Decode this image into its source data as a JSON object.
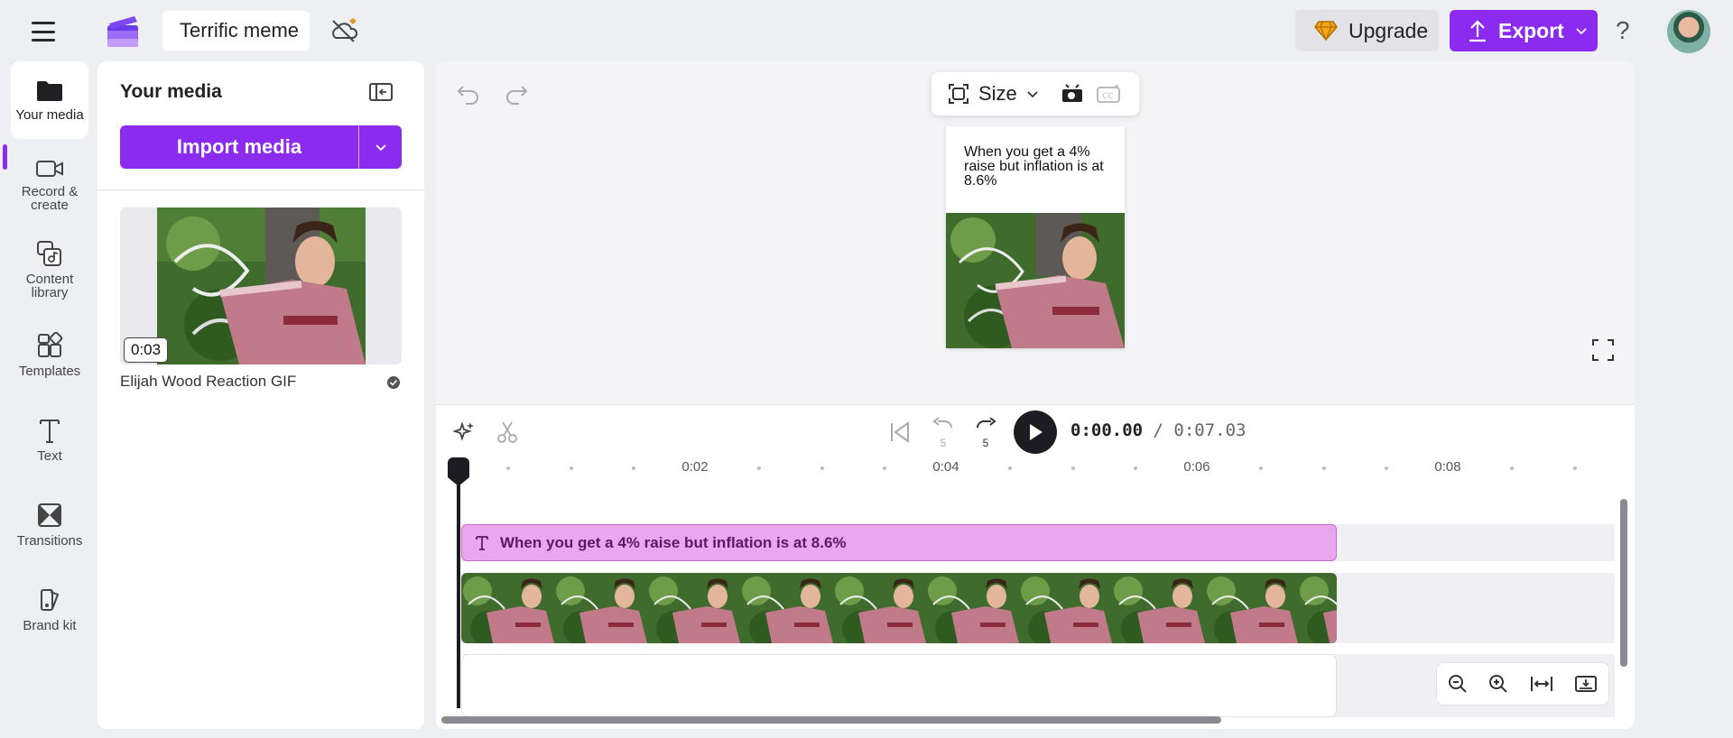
{
  "app": {
    "project_title": "Terrific meme",
    "upgrade_label": "Upgrade",
    "export_label": "Export",
    "help_label": "?",
    "accent_color": "#8b2bf0"
  },
  "rail": {
    "items": [
      {
        "label": "Your media",
        "icon": "folder-icon",
        "active": true
      },
      {
        "label": "Record & create",
        "icon": "video-camera-icon"
      },
      {
        "label": "Content library",
        "icon": "content-library-icon"
      },
      {
        "label": "Templates",
        "icon": "templates-icon"
      },
      {
        "label": "Text",
        "icon": "text-icon"
      },
      {
        "label": "Transitions",
        "icon": "transitions-icon"
      },
      {
        "label": "Brand kit",
        "icon": "brand-kit-icon"
      }
    ]
  },
  "media_panel": {
    "title": "Your media",
    "import_label": "Import media",
    "items": [
      {
        "name": "Elijah Wood Reaction GIF",
        "duration": "0:03"
      }
    ]
  },
  "preview": {
    "size_label": "Size",
    "caption": "When you get a 4% raise but inflation is at 8.6%"
  },
  "timeline": {
    "current_time": "0:00.00",
    "separator": " / ",
    "total_time": "0:07.03",
    "back_seconds": "5",
    "forward_seconds": "5",
    "ruler_labels": [
      "0:02",
      "0:04",
      "0:06",
      "0:08"
    ],
    "text_clip_label": "When you get a 4% raise but inflation is at 8.6%"
  }
}
